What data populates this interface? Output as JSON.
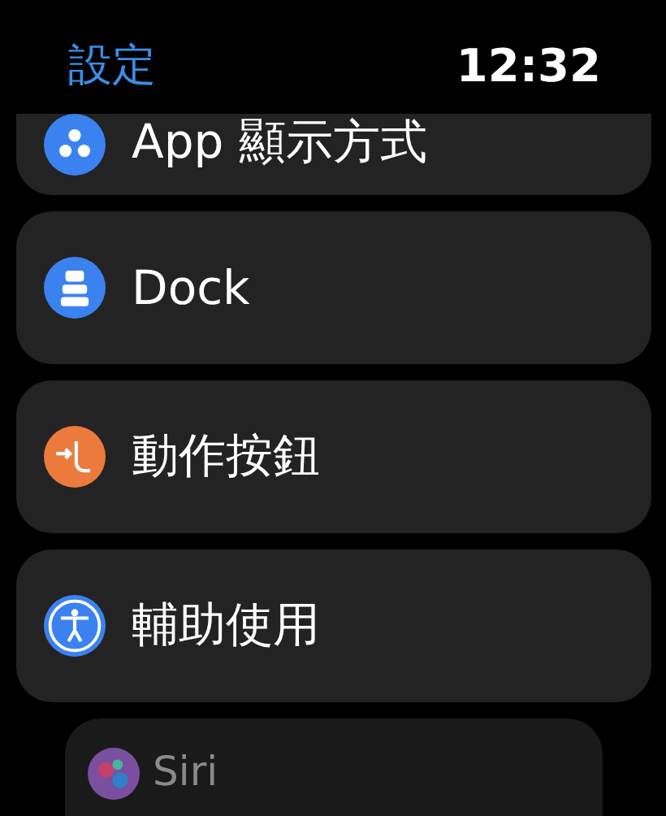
{
  "header": {
    "back": "設定",
    "time": "12:32"
  },
  "items": [
    {
      "label": "App 顯示方式",
      "kind": "app-view",
      "color": "#3b82f0",
      "faded": false
    },
    {
      "label": "Dock",
      "kind": "dock",
      "color": "#3b82f0",
      "faded": false
    },
    {
      "label": "動作按鈕",
      "kind": "action-button",
      "color": "#ec7a3c",
      "faded": false
    },
    {
      "label": "輔助使用",
      "kind": "accessibility",
      "color": "#3b82f0",
      "faded": false
    },
    {
      "label": "Siri",
      "kind": "siri",
      "color": "#7a4fa0",
      "faded": true
    }
  ]
}
